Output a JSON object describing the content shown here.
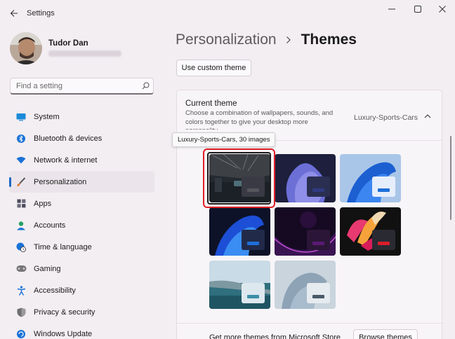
{
  "window": {
    "title": "Settings",
    "icons": {
      "back": "back-arrow-icon",
      "minimize": "minimize-icon",
      "maximize": "maximize-icon",
      "close": "close-icon"
    }
  },
  "user": {
    "name": "Tudor Dan"
  },
  "search": {
    "placeholder": "Find a setting",
    "icon": "search-icon"
  },
  "sidebar": {
    "items": [
      {
        "label": "System",
        "icon": "display-icon",
        "active": false
      },
      {
        "label": "Bluetooth & devices",
        "icon": "bluetooth-icon",
        "active": false
      },
      {
        "label": "Network & internet",
        "icon": "wifi-icon",
        "active": false
      },
      {
        "label": "Personalization",
        "icon": "brush-icon",
        "active": true
      },
      {
        "label": "Apps",
        "icon": "apps-icon",
        "active": false
      },
      {
        "label": "Accounts",
        "icon": "account-icon",
        "active": false
      },
      {
        "label": "Time & language",
        "icon": "globe-clock-icon",
        "active": false
      },
      {
        "label": "Gaming",
        "icon": "gamepad-icon",
        "active": false
      },
      {
        "label": "Accessibility",
        "icon": "accessibility-icon",
        "active": false
      },
      {
        "label": "Privacy & security",
        "icon": "shield-icon",
        "active": false
      },
      {
        "label": "Windows Update",
        "icon": "update-icon",
        "active": false
      }
    ]
  },
  "header": {
    "parent": "Personalization",
    "current": "Themes"
  },
  "custom_theme_button": "Use custom theme",
  "current_theme": {
    "title": "Current theme",
    "description": "Choose a combination of wallpapers, sounds, and colors together to give your desktop more personality",
    "value": "Luxury-Sports-Cars"
  },
  "tooltip": "Luxury-Sports-Cars, 30 images",
  "themes": [
    {
      "id": "luxury-sports-cars",
      "bar_color": "#3a3a44",
      "accent": "#55555e",
      "selected": true
    },
    {
      "id": "windows-dark-purple",
      "bar_color": "#2a2f52",
      "accent": "#2f3a80"
    },
    {
      "id": "windows-light",
      "bar_color": "#e6eefc",
      "accent": "#1e6fd9"
    },
    {
      "id": "windows-dark",
      "bar_color": "#222a4a",
      "accent": "#1e6fd9"
    },
    {
      "id": "glow",
      "bar_color": "#2b1638",
      "accent": "#5a1a74"
    },
    {
      "id": "captured-motion",
      "bar_color": "#2a2a33",
      "accent": "#d91e2a"
    },
    {
      "id": "sunrise",
      "bar_color": "#dde8ee",
      "accent": "#3d8fa8"
    },
    {
      "id": "flow",
      "bar_color": "#e6ebef",
      "accent": "#4a5a69"
    }
  ],
  "store": {
    "text": "Get more themes from Microsoft Store",
    "button": "Browse themes"
  }
}
